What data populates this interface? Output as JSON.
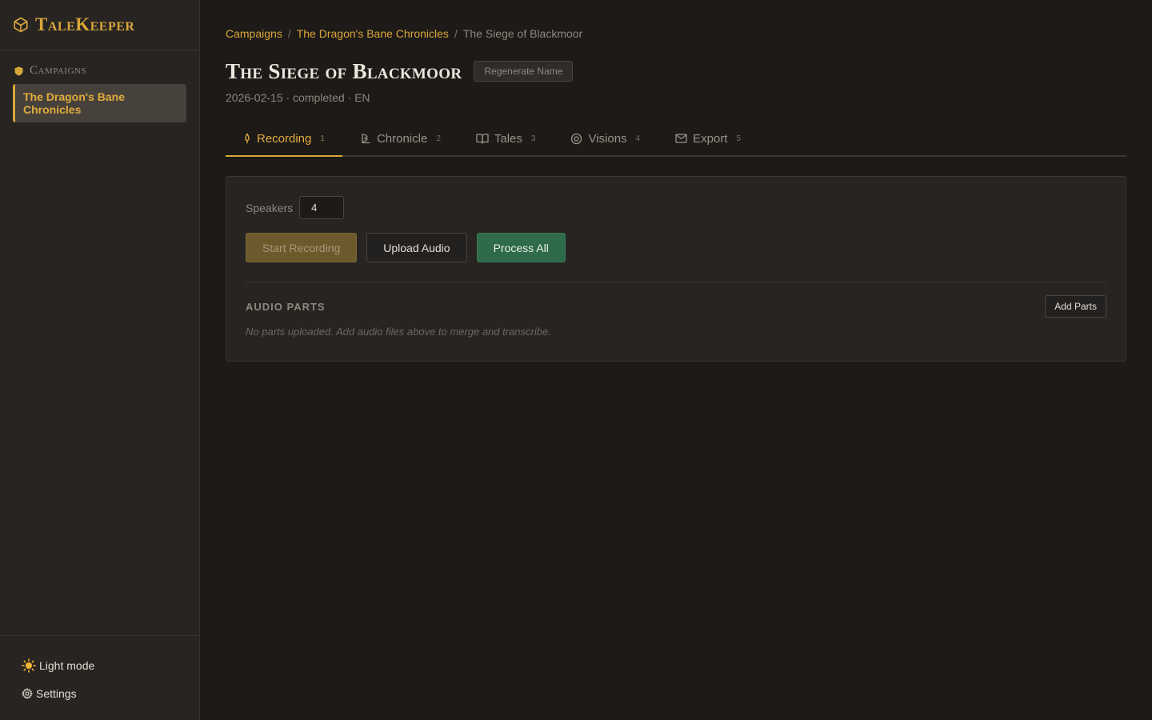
{
  "app": {
    "name": "TaleKeeper",
    "accent": "#d9a63a"
  },
  "sidebar": {
    "section_title": "Campaigns",
    "campaigns": [
      {
        "label": "The Dragon's Bane Chronicles",
        "selected": true
      }
    ],
    "footer": {
      "theme_label": "Light mode",
      "settings_label": "Settings"
    }
  },
  "breadcrumb": {
    "items": [
      "Campaigns",
      "The Dragon's Bane Chronicles"
    ],
    "separator": "/",
    "current": "The Siege of Blackmoor"
  },
  "page": {
    "title": "The Siege of Blackmoor",
    "regenerate_label": "Regenerate Name",
    "meta": "2026-02-15 · completed · EN"
  },
  "tabs": [
    {
      "label": "Recording",
      "shortcut": "1",
      "icon": "mic-icon",
      "active": true
    },
    {
      "label": "Chronicle",
      "shortcut": "2",
      "icon": "quill-icon",
      "active": false
    },
    {
      "label": "Tales",
      "shortcut": "3",
      "icon": "book-icon",
      "active": false
    },
    {
      "label": "Visions",
      "shortcut": "4",
      "icon": "eye-icon",
      "active": false
    },
    {
      "label": "Export",
      "shortcut": "5",
      "icon": "mail-icon",
      "active": false
    }
  ],
  "recording": {
    "speakers_label": "Speakers",
    "speakers_value": "4",
    "start_label": "Start Recording",
    "upload_label": "Upload Audio",
    "process_label": "Process All",
    "parts_title": "AUDIO PARTS",
    "add_parts_label": "Add Parts",
    "empty_text": "No parts uploaded. Add audio files above to merge and transcribe."
  }
}
